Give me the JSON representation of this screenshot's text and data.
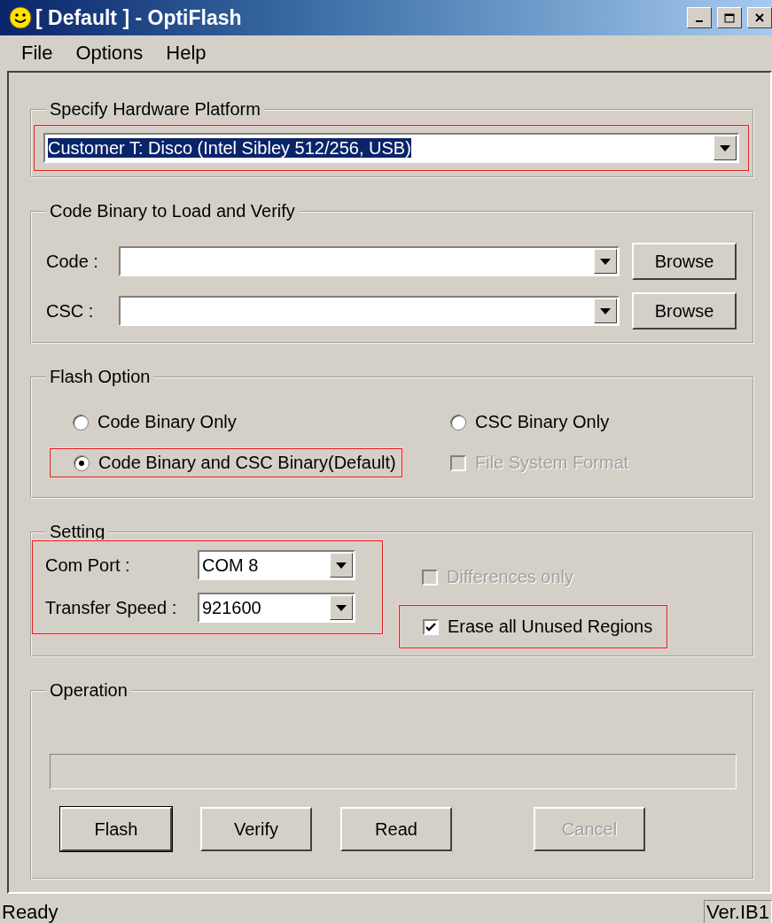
{
  "window": {
    "title": "[ Default ] - OptiFlash"
  },
  "menu": [
    "File",
    "Options",
    "Help"
  ],
  "platform": {
    "legend": "Specify Hardware Platform",
    "value": "Customer T: Disco (Intel Sibley 512/256, USB)",
    "highlighted": true
  },
  "code_binary": {
    "legend": "Code Binary to Load and Verify",
    "rows": [
      {
        "label": "Code :",
        "button": "Browse"
      },
      {
        "label": "CSC :",
        "button": "Browse"
      }
    ]
  },
  "flash_option": {
    "legend": "Flash Option",
    "options": [
      {
        "kind": "radio",
        "label": "Code Binary Only",
        "selected": false
      },
      {
        "kind": "radio",
        "label": "CSC Binary Only",
        "selected": false
      },
      {
        "kind": "radio",
        "label": "Code Binary and CSC Binary(Default)",
        "selected": true
      },
      {
        "kind": "checkbox",
        "label": "File System Format",
        "checked": false,
        "disabled": true
      }
    ]
  },
  "setting": {
    "legend": "Setting",
    "fields": [
      {
        "label": "Com Port :",
        "value": "COM 8"
      },
      {
        "label": "Transfer Speed :",
        "value": "921600"
      }
    ],
    "checks": [
      {
        "label": "Differences only",
        "checked": false,
        "disabled": true
      },
      {
        "label": "Erase all Unused Regions",
        "checked": true,
        "disabled": false
      }
    ]
  },
  "operation": {
    "legend": "Operation",
    "progress": {
      "level": 0
    },
    "buttons": [
      {
        "label": "Flash",
        "default": true,
        "disabled": false
      },
      {
        "label": "Verify",
        "default": false,
        "disabled": false
      },
      {
        "label": "Read",
        "default": false,
        "disabled": false
      },
      {
        "label": "Cancel",
        "default": false,
        "disabled": true
      }
    ]
  },
  "status_bar": {
    "text": "Ready",
    "version": "Ver.IB1"
  }
}
